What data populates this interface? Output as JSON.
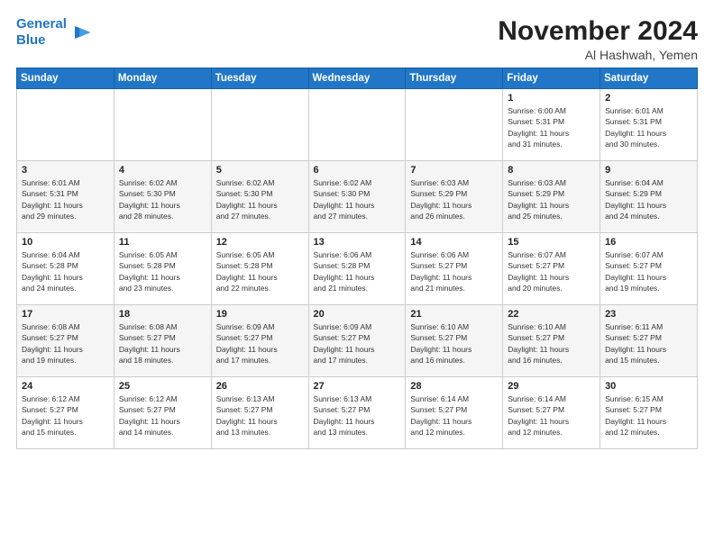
{
  "logo": {
    "line1": "General",
    "line2": "Blue"
  },
  "title": "November 2024",
  "location": "Al Hashwah, Yemen",
  "days_of_week": [
    "Sunday",
    "Monday",
    "Tuesday",
    "Wednesday",
    "Thursday",
    "Friday",
    "Saturday"
  ],
  "weeks": [
    [
      {
        "day": "",
        "info": ""
      },
      {
        "day": "",
        "info": ""
      },
      {
        "day": "",
        "info": ""
      },
      {
        "day": "",
        "info": ""
      },
      {
        "day": "",
        "info": ""
      },
      {
        "day": "1",
        "info": "Sunrise: 6:00 AM\nSunset: 5:31 PM\nDaylight: 11 hours\nand 31 minutes."
      },
      {
        "day": "2",
        "info": "Sunrise: 6:01 AM\nSunset: 5:31 PM\nDaylight: 11 hours\nand 30 minutes."
      }
    ],
    [
      {
        "day": "3",
        "info": "Sunrise: 6:01 AM\nSunset: 5:31 PM\nDaylight: 11 hours\nand 29 minutes."
      },
      {
        "day": "4",
        "info": "Sunrise: 6:02 AM\nSunset: 5:30 PM\nDaylight: 11 hours\nand 28 minutes."
      },
      {
        "day": "5",
        "info": "Sunrise: 6:02 AM\nSunset: 5:30 PM\nDaylight: 11 hours\nand 27 minutes."
      },
      {
        "day": "6",
        "info": "Sunrise: 6:02 AM\nSunset: 5:30 PM\nDaylight: 11 hours\nand 27 minutes."
      },
      {
        "day": "7",
        "info": "Sunrise: 6:03 AM\nSunset: 5:29 PM\nDaylight: 11 hours\nand 26 minutes."
      },
      {
        "day": "8",
        "info": "Sunrise: 6:03 AM\nSunset: 5:29 PM\nDaylight: 11 hours\nand 25 minutes."
      },
      {
        "day": "9",
        "info": "Sunrise: 6:04 AM\nSunset: 5:29 PM\nDaylight: 11 hours\nand 24 minutes."
      }
    ],
    [
      {
        "day": "10",
        "info": "Sunrise: 6:04 AM\nSunset: 5:28 PM\nDaylight: 11 hours\nand 24 minutes."
      },
      {
        "day": "11",
        "info": "Sunrise: 6:05 AM\nSunset: 5:28 PM\nDaylight: 11 hours\nand 23 minutes."
      },
      {
        "day": "12",
        "info": "Sunrise: 6:05 AM\nSunset: 5:28 PM\nDaylight: 11 hours\nand 22 minutes."
      },
      {
        "day": "13",
        "info": "Sunrise: 6:06 AM\nSunset: 5:28 PM\nDaylight: 11 hours\nand 21 minutes."
      },
      {
        "day": "14",
        "info": "Sunrise: 6:06 AM\nSunset: 5:27 PM\nDaylight: 11 hours\nand 21 minutes."
      },
      {
        "day": "15",
        "info": "Sunrise: 6:07 AM\nSunset: 5:27 PM\nDaylight: 11 hours\nand 20 minutes."
      },
      {
        "day": "16",
        "info": "Sunrise: 6:07 AM\nSunset: 5:27 PM\nDaylight: 11 hours\nand 19 minutes."
      }
    ],
    [
      {
        "day": "17",
        "info": "Sunrise: 6:08 AM\nSunset: 5:27 PM\nDaylight: 11 hours\nand 19 minutes."
      },
      {
        "day": "18",
        "info": "Sunrise: 6:08 AM\nSunset: 5:27 PM\nDaylight: 11 hours\nand 18 minutes."
      },
      {
        "day": "19",
        "info": "Sunrise: 6:09 AM\nSunset: 5:27 PM\nDaylight: 11 hours\nand 17 minutes."
      },
      {
        "day": "20",
        "info": "Sunrise: 6:09 AM\nSunset: 5:27 PM\nDaylight: 11 hours\nand 17 minutes."
      },
      {
        "day": "21",
        "info": "Sunrise: 6:10 AM\nSunset: 5:27 PM\nDaylight: 11 hours\nand 16 minutes."
      },
      {
        "day": "22",
        "info": "Sunrise: 6:10 AM\nSunset: 5:27 PM\nDaylight: 11 hours\nand 16 minutes."
      },
      {
        "day": "23",
        "info": "Sunrise: 6:11 AM\nSunset: 5:27 PM\nDaylight: 11 hours\nand 15 minutes."
      }
    ],
    [
      {
        "day": "24",
        "info": "Sunrise: 6:12 AM\nSunset: 5:27 PM\nDaylight: 11 hours\nand 15 minutes."
      },
      {
        "day": "25",
        "info": "Sunrise: 6:12 AM\nSunset: 5:27 PM\nDaylight: 11 hours\nand 14 minutes."
      },
      {
        "day": "26",
        "info": "Sunrise: 6:13 AM\nSunset: 5:27 PM\nDaylight: 11 hours\nand 13 minutes."
      },
      {
        "day": "27",
        "info": "Sunrise: 6:13 AM\nSunset: 5:27 PM\nDaylight: 11 hours\nand 13 minutes."
      },
      {
        "day": "28",
        "info": "Sunrise: 6:14 AM\nSunset: 5:27 PM\nDaylight: 11 hours\nand 12 minutes."
      },
      {
        "day": "29",
        "info": "Sunrise: 6:14 AM\nSunset: 5:27 PM\nDaylight: 11 hours\nand 12 minutes."
      },
      {
        "day": "30",
        "info": "Sunrise: 6:15 AM\nSunset: 5:27 PM\nDaylight: 11 hours\nand 12 minutes."
      }
    ]
  ]
}
